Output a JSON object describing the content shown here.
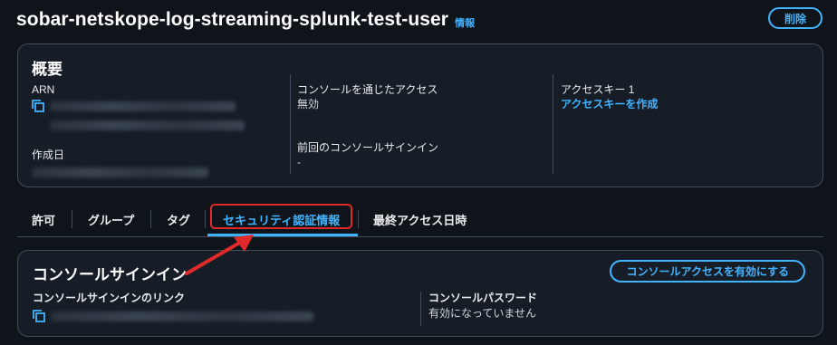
{
  "header": {
    "title": "sobar-netskope-log-streaming-splunk-test-user",
    "info": "情報",
    "delete_label": "削除"
  },
  "summary": {
    "heading": "概要",
    "arn_label": "ARN",
    "created_label": "作成日",
    "console_access_label": "コンソールを通じたアクセス",
    "console_access_value": "無効",
    "last_signin_label": "前回のコンソールサインイン",
    "last_signin_value": "-",
    "access_key_label": "アクセスキー 1",
    "access_key_link": "アクセスキーを作成"
  },
  "tabs": [
    {
      "label": "許可"
    },
    {
      "label": "グループ"
    },
    {
      "label": "タグ"
    },
    {
      "label": "セキュリティ認証情報"
    },
    {
      "label": "最終アクセス日時"
    }
  ],
  "console_signin": {
    "heading": "コンソールサインイン",
    "enable_button": "コンソールアクセスを有効にする",
    "link_label": "コンソールサインインのリンク",
    "password_label": "コンソールパスワード",
    "password_value": "有効になっていません"
  },
  "colors": {
    "background": "#0f141a",
    "panel": "#161d26",
    "border": "#414d5c",
    "link": "#42b4ff",
    "annotation": "#e02a2a"
  }
}
